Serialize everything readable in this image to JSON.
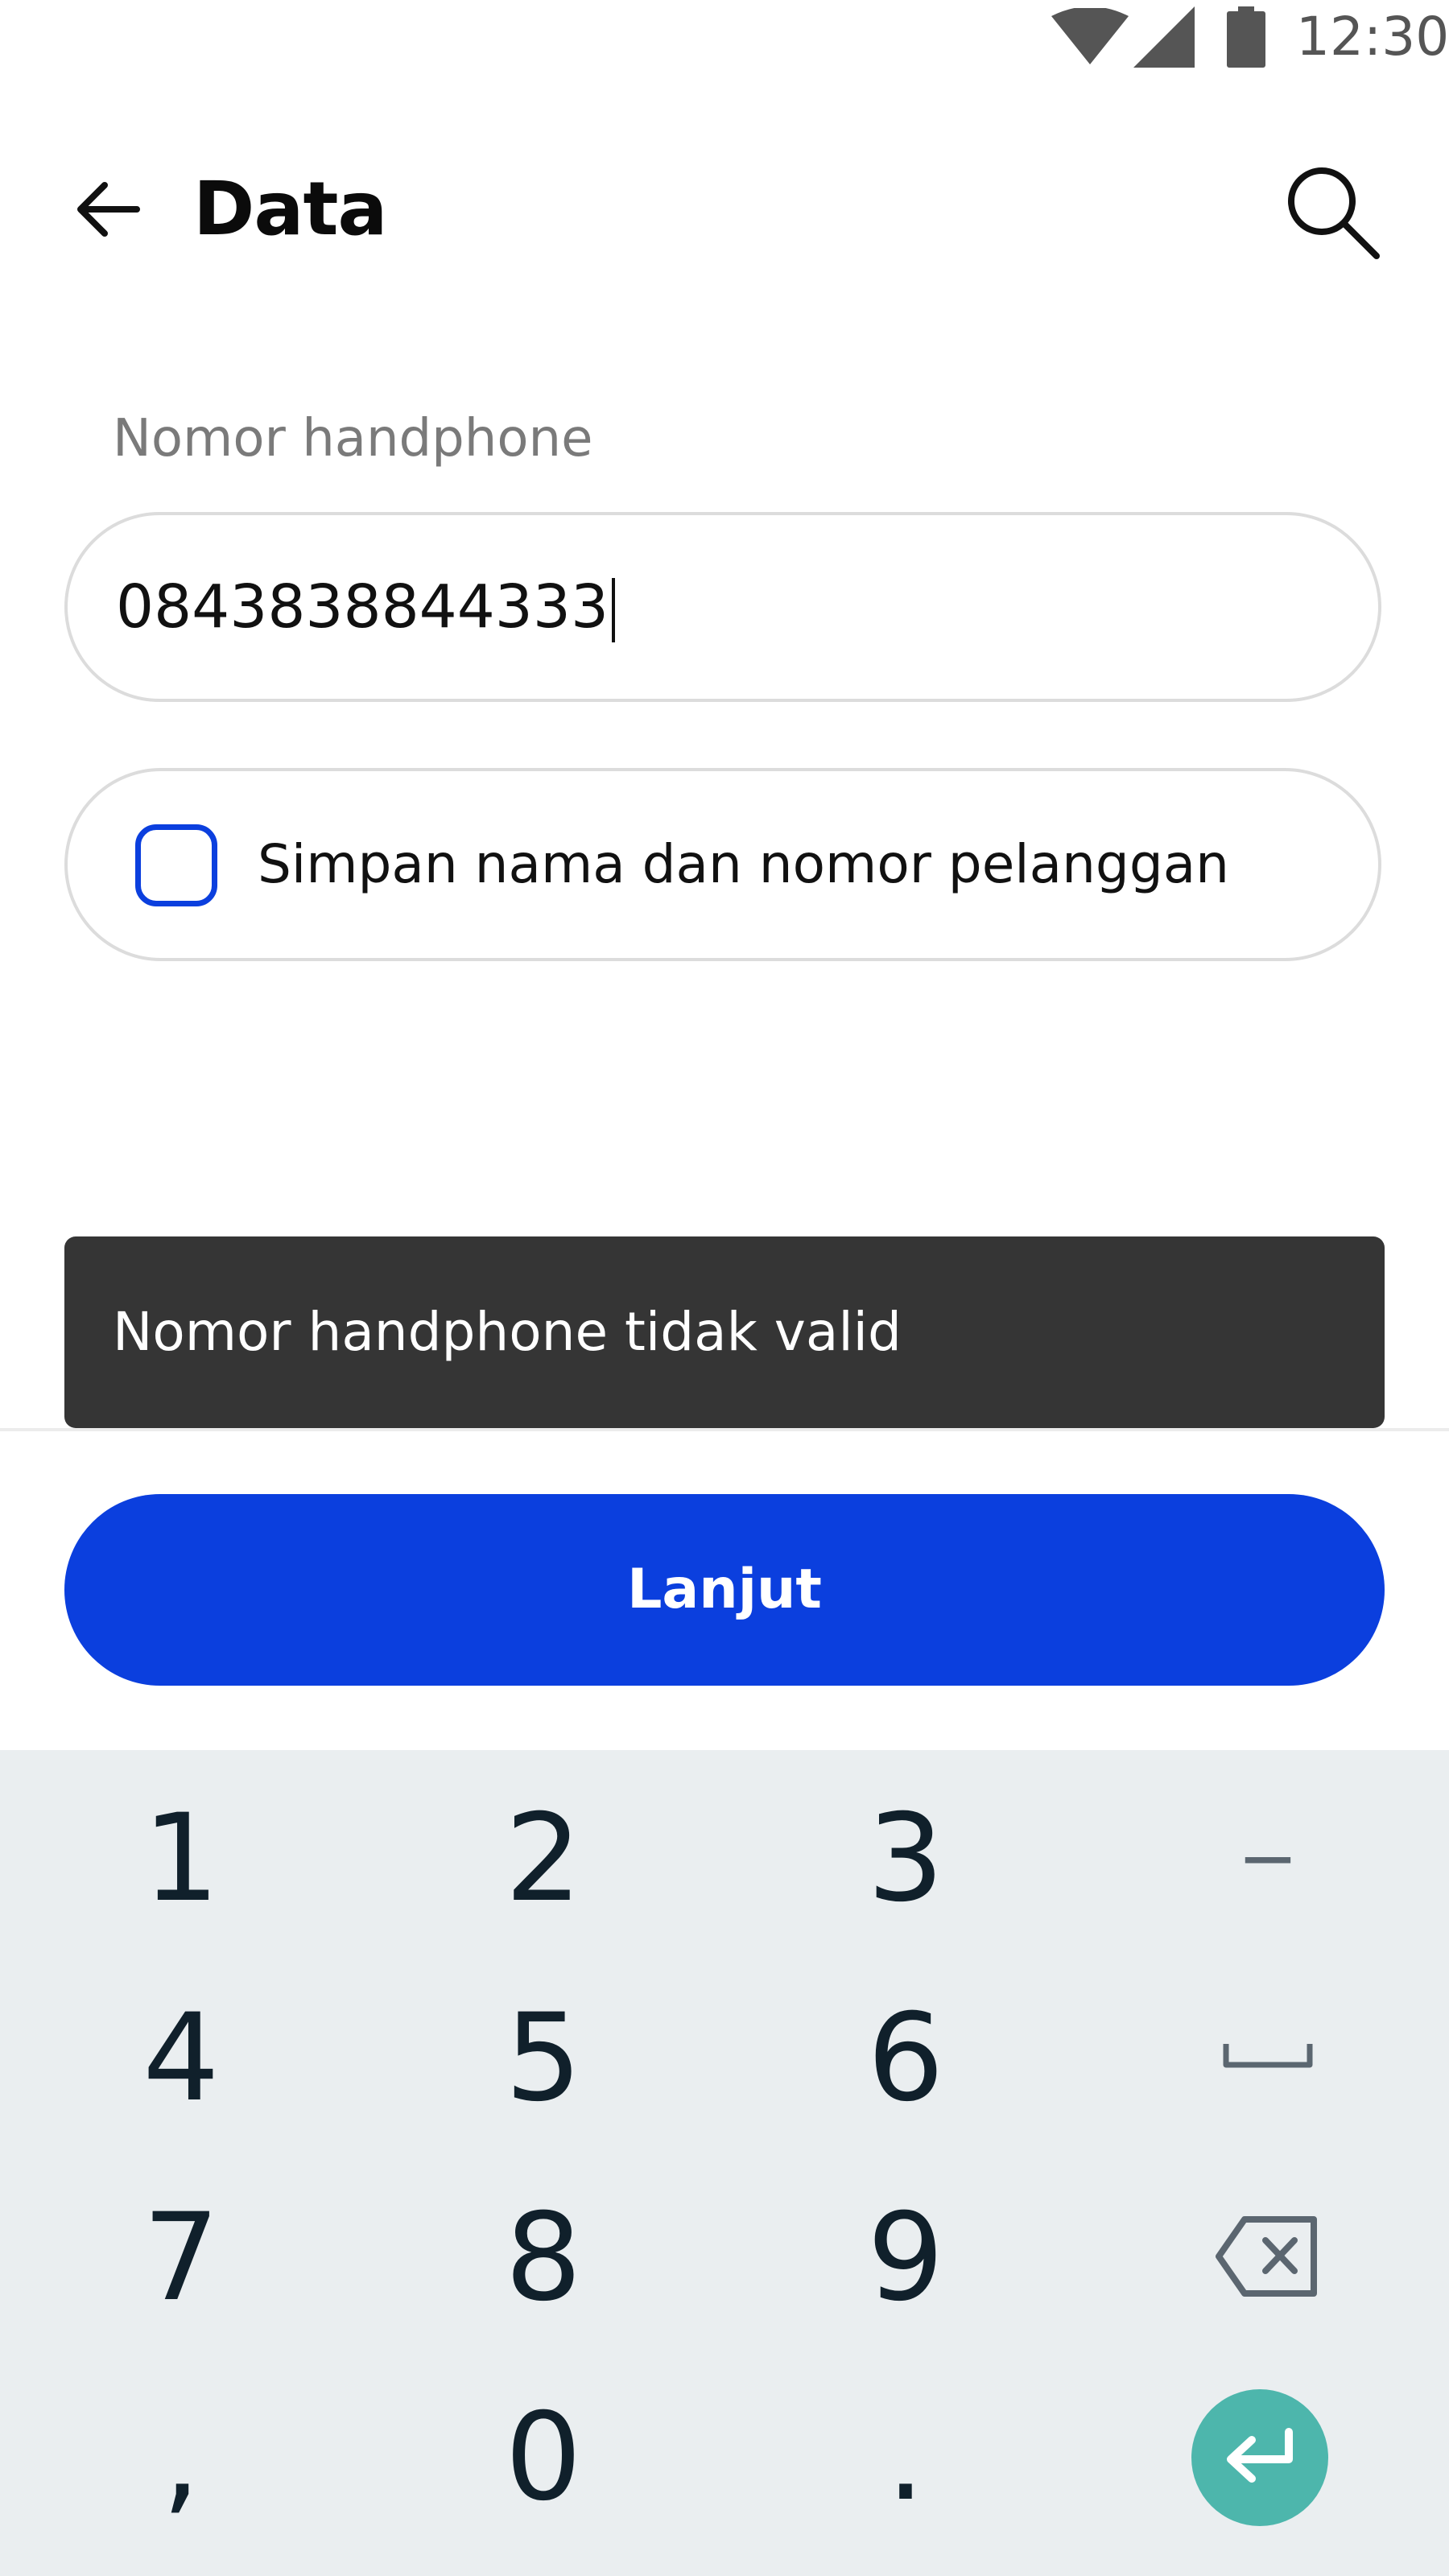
{
  "status_bar": {
    "time": "12:30",
    "icons": [
      "wifi-icon",
      "signal-icon",
      "battery-icon"
    ]
  },
  "app_bar": {
    "title": "Data",
    "back_icon": "arrow-left-icon",
    "search_icon": "search-icon"
  },
  "form": {
    "phone_label": "Nomor handphone",
    "phone_value": "0843838844333",
    "save_label": "Simpan nama dan nomor pelanggan",
    "save_checked": false
  },
  "toast": {
    "message": "Nomor handphone tidak valid"
  },
  "actions": {
    "continue_label": "Lanjut"
  },
  "keyboard": {
    "rows": [
      [
        "1",
        "2",
        "3",
        "−"
      ],
      [
        "4",
        "5",
        "6",
        "space-icon"
      ],
      [
        "7",
        "8",
        "9",
        "backspace-icon"
      ],
      [
        ",",
        "0",
        ".",
        "enter-icon"
      ]
    ]
  },
  "colors": {
    "primary": "#0b3fde",
    "toast_bg": "#353535",
    "keyboard_bg": "#eaeef0",
    "enter_key": "#4db6ac",
    "border": "#dcdcdc"
  }
}
